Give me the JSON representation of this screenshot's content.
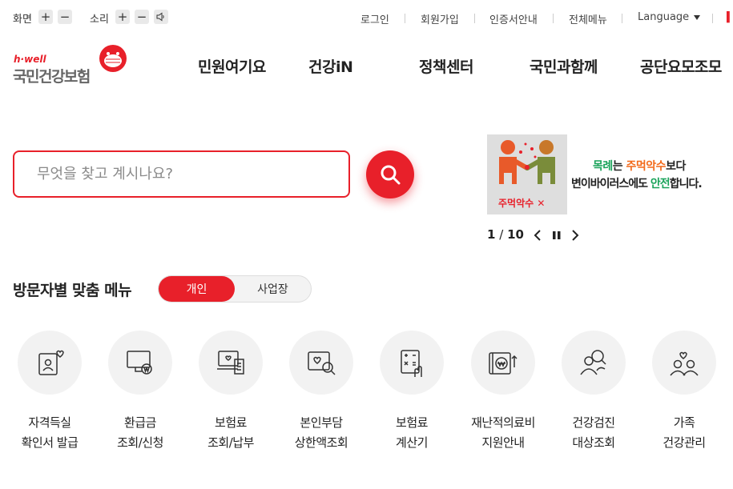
{
  "utility": {
    "screen_label": "화면",
    "sound_label": "소리",
    "plus": "+",
    "minus": "−",
    "links": [
      "로그인",
      "회원가입",
      "인증서안내",
      "전체메뉴",
      "Language"
    ]
  },
  "logo": {
    "tagline": "h·well",
    "name": "국민건강보험"
  },
  "nav": [
    "민원여기요",
    "건강iN",
    "정책센터",
    "국민과함께",
    "공단요모조모"
  ],
  "search": {
    "placeholder": "무엇을 찾고 계시나요?"
  },
  "banner": {
    "image_caption": "주먹악수 ✕",
    "line1": [
      "목례",
      "는 ",
      "주먹악수",
      "보다"
    ],
    "line2": [
      "변이바이러스에도 ",
      "안전",
      "합니다."
    ],
    "pager": {
      "current": "1",
      "separator": "/",
      "total": "10"
    }
  },
  "custom_menu": {
    "title": "방문자별 맞춤 메뉴",
    "tab_personal": "개인",
    "tab_business": "사업장",
    "items": [
      {
        "line1": "자격득실",
        "line2": "확인서 발급",
        "icon": "id-card-heart-icon"
      },
      {
        "line1": "환급금",
        "line2": "조회/신청",
        "icon": "monitor-won-icon"
      },
      {
        "line1": "보험료",
        "line2": "조회/납부",
        "icon": "laptop-receipt-icon"
      },
      {
        "line1": "본인부담",
        "line2": "상한액조회",
        "icon": "heart-search-icon"
      },
      {
        "line1": "보험료",
        "line2": "계산기",
        "icon": "calculator-hand-icon"
      },
      {
        "line1": "재난적의료비",
        "line2": "지원안내",
        "icon": "won-card-upload-icon"
      },
      {
        "line1": "건강검진",
        "line2": "대상조회",
        "icon": "people-search-icon"
      },
      {
        "line1": "가족",
        "line2": "건강관리",
        "icon": "family-heart-icon"
      }
    ]
  },
  "colors": {
    "accent": "#e8202a",
    "green": "#1aa35a",
    "orange": "#f26a1b"
  }
}
